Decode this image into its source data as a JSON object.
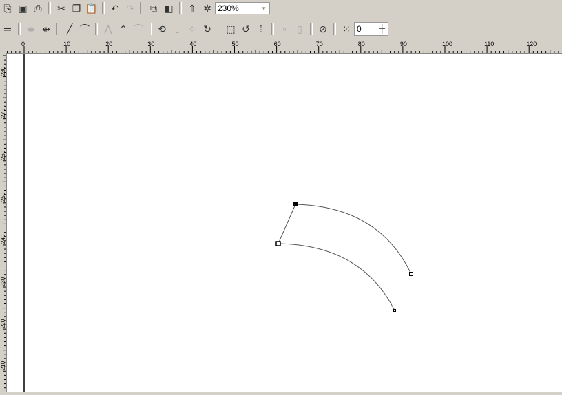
{
  "toolbar1": {
    "icons": [
      "open-icon",
      "save-icon",
      "print-icon",
      "cut-icon",
      "copy-icon",
      "paste-icon",
      "undo-icon",
      "redo-icon",
      "import-icon",
      "export-icon",
      "launcher-icon",
      "welcome-icon"
    ],
    "zoom": "230%"
  },
  "toolbar2": {
    "icons": [
      "node-icon",
      "add-node-icon",
      "delete-node-icon",
      "join-nodes-icon",
      "break-curve-icon",
      "to-line-icon",
      "to-curve-icon",
      "cusp-icon",
      "smooth-icon",
      "symmetrical-icon",
      "reverse-icon",
      "extend-icon",
      "extract-icon",
      "auto-close-icon",
      "stretch-icon",
      "rotate-icon",
      "align-icon",
      "elastic-icon",
      "reflect-icon",
      "reduce-icon"
    ],
    "curve_smoothness": "0"
  },
  "rulers": {
    "horizontal": [
      "0",
      "10",
      "20",
      "30",
      "40",
      "50",
      "60",
      "70",
      "80",
      "90",
      "100",
      "110",
      "120"
    ],
    "vertical": [
      "280",
      "270",
      "260",
      "250",
      "240",
      "230",
      "220",
      "210"
    ]
  }
}
